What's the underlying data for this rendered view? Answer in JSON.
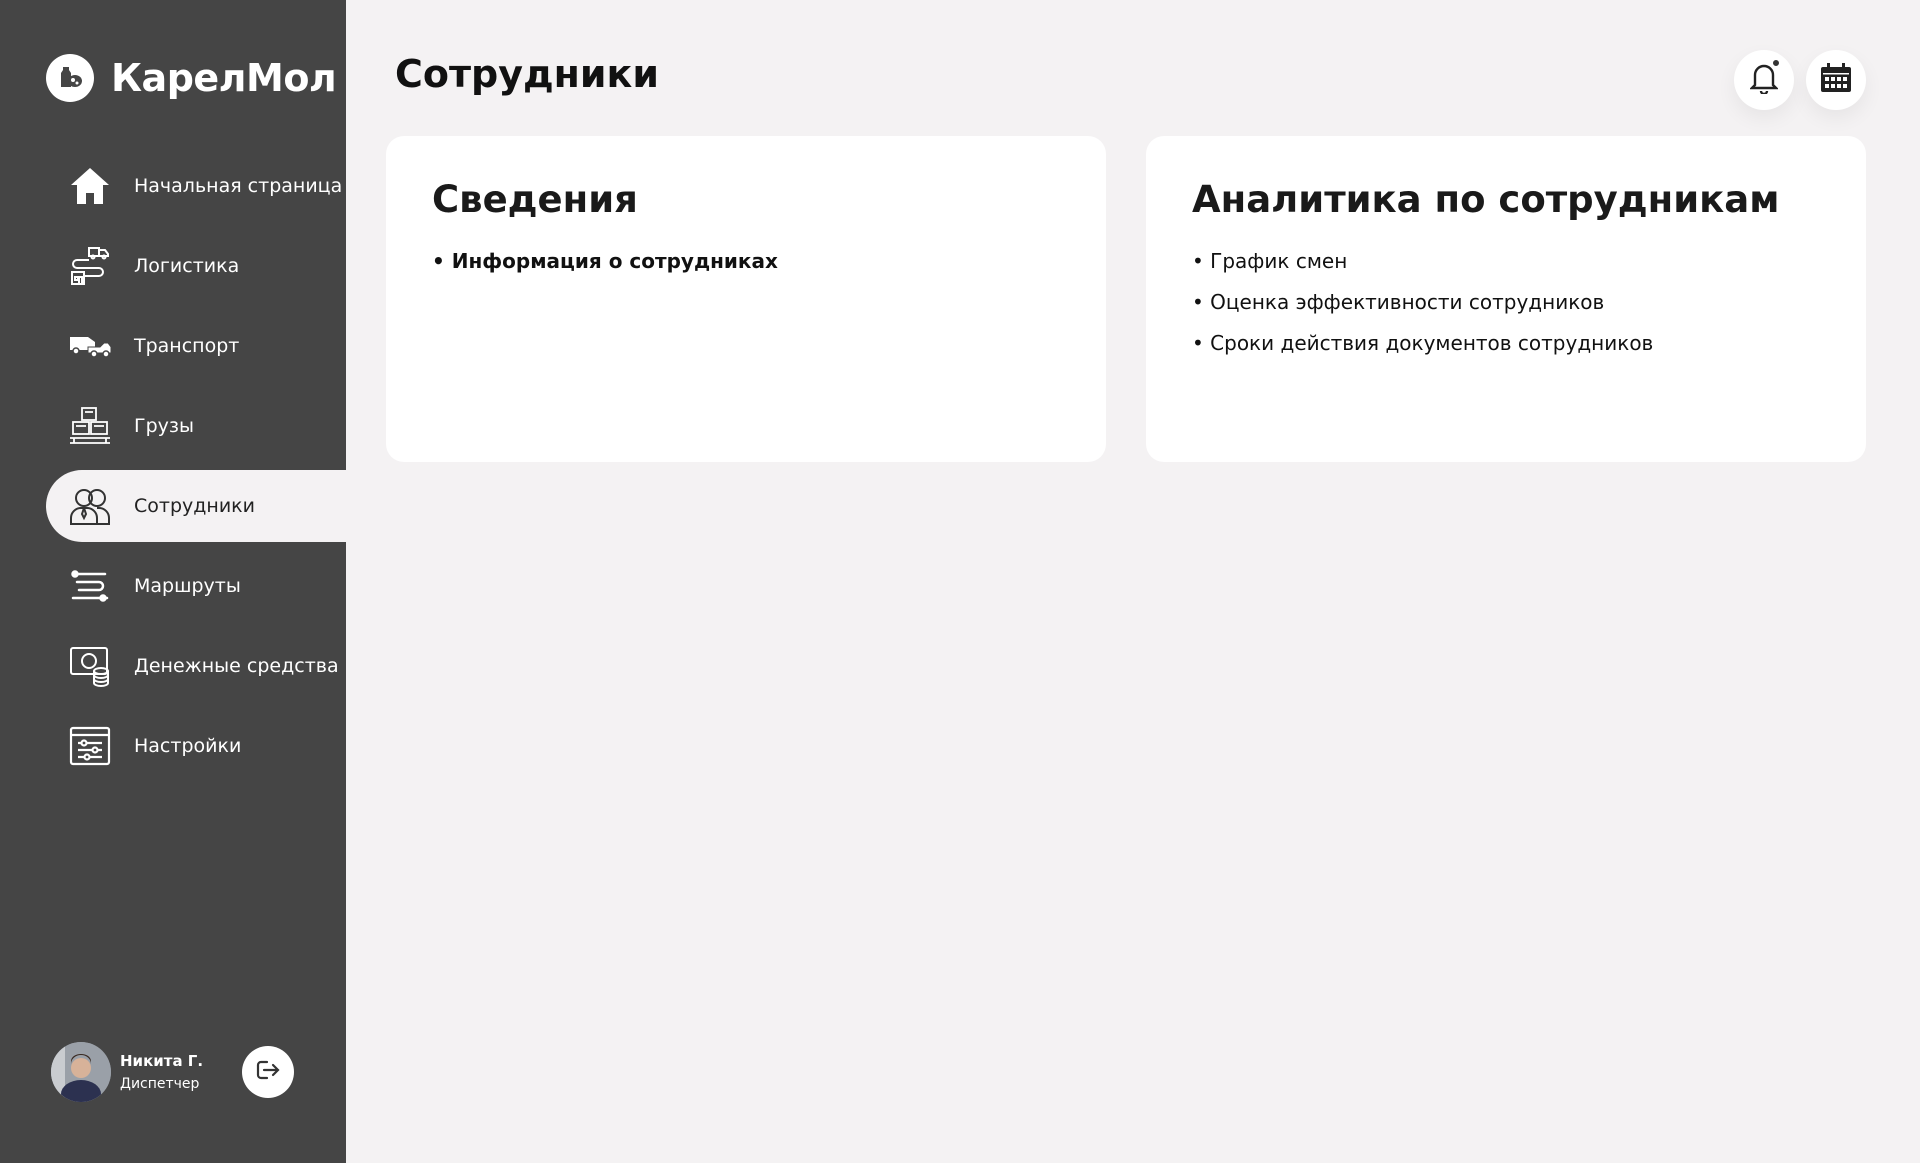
{
  "brand": {
    "name": "КарелМол",
    "logo_icon": "milk-bottle-logo-icon"
  },
  "page": {
    "title": "Сотрудники"
  },
  "sidebar": {
    "items": [
      {
        "label": "Начальная страница",
        "icon": "home-icon",
        "active": false
      },
      {
        "label": "Логистика",
        "icon": "logistics-icon",
        "active": false
      },
      {
        "label": "Транспорт",
        "icon": "transport-icon",
        "active": false
      },
      {
        "label": "Грузы",
        "icon": "cargo-icon",
        "active": false
      },
      {
        "label": "Сотрудники",
        "icon": "employees-icon",
        "active": true
      },
      {
        "label": "Маршруты",
        "icon": "routes-icon",
        "active": false
      },
      {
        "label": "Денежные средства",
        "icon": "money-icon",
        "active": false
      },
      {
        "label": "Настройки",
        "icon": "settings-icon",
        "active": false
      }
    ]
  },
  "user": {
    "name": "Никита Г.",
    "role": "Диспетчер"
  },
  "header": {
    "notifications_icon": "bell-icon",
    "calendar_icon": "calendar-icon",
    "has_unread": true
  },
  "cards": [
    {
      "title": "Сведения",
      "items": [
        "Информация о сотрудниках"
      ]
    },
    {
      "title": "Аналитика по сотрудникам",
      "items": [
        "График смен",
        "Оценка эффективности сотрудников",
        "Сроки действия документов сотрудников"
      ]
    }
  ],
  "colors": {
    "sidebar": "#454545",
    "background": "#f4f2f3",
    "card": "#ffffff"
  }
}
